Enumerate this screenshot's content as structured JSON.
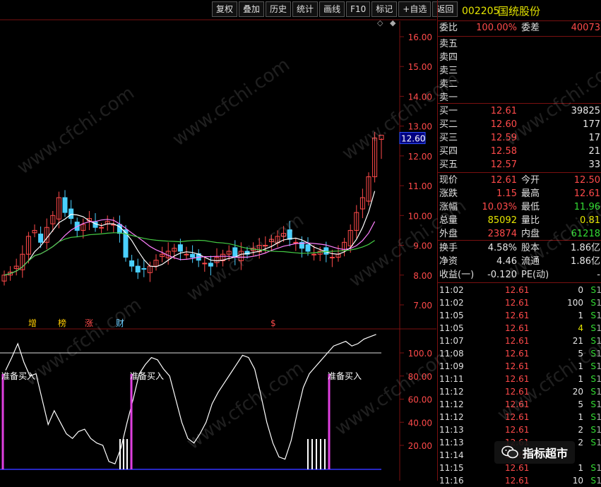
{
  "toolbar": [
    "复权",
    "叠加",
    "历史",
    "统计",
    "画线",
    "F10",
    "标记",
    "+自选",
    "返回"
  ],
  "stock": {
    "code": "002205",
    "name": "国统股份"
  },
  "weibi": {
    "label": "委比",
    "value": "100.00%",
    "label2": "委差",
    "value2": "40073"
  },
  "sell": [
    {
      "label": "卖五"
    },
    {
      "label": "卖四"
    },
    {
      "label": "卖三"
    },
    {
      "label": "卖二"
    },
    {
      "label": "卖一"
    }
  ],
  "buy": [
    {
      "label": "买一",
      "price": "12.61",
      "vol": "39825"
    },
    {
      "label": "买二",
      "price": "12.60",
      "vol": "177"
    },
    {
      "label": "买三",
      "price": "12.59",
      "vol": "17"
    },
    {
      "label": "买四",
      "price": "12.58",
      "vol": "21"
    },
    {
      "label": "买五",
      "price": "12.57",
      "vol": "33"
    }
  ],
  "stats": [
    {
      "l1": "现价",
      "v1": "12.61",
      "l2": "今开",
      "v2": "12.50"
    },
    {
      "l1": "涨跌",
      "v1": "1.15",
      "l2": "最高",
      "v2": "12.61"
    },
    {
      "l1": "涨幅",
      "v1": "10.03%",
      "l2": "最低",
      "v2": "11.96"
    },
    {
      "l1": "总量",
      "v1": "85092",
      "l2": "量比",
      "v2": "0.81"
    },
    {
      "l1": "外盘",
      "v1": "23874",
      "l2": "内盘",
      "v2": "61218"
    }
  ],
  "stats2": [
    {
      "l1": "换手",
      "v1": "4.58%",
      "l2": "股本",
      "v2": "1.86亿"
    },
    {
      "l1": "净资",
      "v1": "4.46",
      "l2": "流通",
      "v2": "1.86亿"
    },
    {
      "l1": "收益(一)",
      "v1": "-0.120",
      "l2": "PE(动)",
      "v2": "-"
    }
  ],
  "ticks": [
    {
      "t": "11:02",
      "p": "12.61",
      "q": "0",
      "s": "S",
      "m": "1"
    },
    {
      "t": "11:02",
      "p": "12.61",
      "q": "100",
      "s": "S",
      "m": "1"
    },
    {
      "t": "11:05",
      "p": "12.61",
      "q": "1",
      "s": "S",
      "m": "1"
    },
    {
      "t": "11:05",
      "p": "12.61",
      "q": "4",
      "s": "S",
      "m": "1"
    },
    {
      "t": "11:07",
      "p": "12.61",
      "q": "21",
      "s": "S",
      "m": "1"
    },
    {
      "t": "11:08",
      "p": "12.61",
      "q": "5",
      "s": "S",
      "m": "1"
    },
    {
      "t": "11:09",
      "p": "12.61",
      "q": "1",
      "s": "S",
      "m": "1"
    },
    {
      "t": "11:11",
      "p": "12.61",
      "q": "1",
      "s": "S",
      "m": "1"
    },
    {
      "t": "11:12",
      "p": "12.61",
      "q": "20",
      "s": "S",
      "m": "1"
    },
    {
      "t": "11:12",
      "p": "12.61",
      "q": "5",
      "s": "S",
      "m": "1"
    },
    {
      "t": "11:12",
      "p": "12.61",
      "q": "1",
      "s": "S",
      "m": "1"
    },
    {
      "t": "11:13",
      "p": "12.61",
      "q": "2",
      "s": "S",
      "m": "1"
    },
    {
      "t": "11:13",
      "p": "12.61",
      "q": "2",
      "s": "S",
      "m": "1"
    },
    {
      "t": "11:14",
      "p": "12.61",
      "q": "",
      "s": "",
      "m": ""
    },
    {
      "t": "11:15",
      "p": "12.61",
      "q": "1",
      "s": "S",
      "m": "1"
    },
    {
      "t": "11:16",
      "p": "12.61",
      "q": "10",
      "s": "S",
      "m": "1"
    }
  ],
  "price_axis": [
    "16.00",
    "15.00",
    "14.00",
    "13.00",
    "12.00",
    "11.00",
    "10.00",
    "9.00",
    "8.00",
    "7.00"
  ],
  "current_price_tag": "12.60",
  "osc_axis": [
    "100.0",
    "80.00",
    "60.00",
    "40.00",
    "20.00"
  ],
  "event_labels": [
    {
      "text": "增",
      "color": "#ffcc00"
    },
    {
      "text": "榜",
      "color": "#ffcc00"
    },
    {
      "text": "涨",
      "color": "#ff4a4a"
    },
    {
      "text": "财",
      "color": "#66ccff"
    },
    {
      "text": "$",
      "color": "#ff4a4a"
    }
  ],
  "signals": [
    "准备买入",
    "准备买入",
    "准备买入"
  ],
  "watermark": "www.cfchi.com",
  "wechat_label": "指标超市",
  "colors": {
    "up": "#ff4a4a",
    "down": "#4ad0ff",
    "ma1": "#ffffff",
    "ma2": "#ff80ff",
    "ma3": "#44cc44",
    "frame": "#7a1010",
    "signal": "#e040e0"
  }
}
